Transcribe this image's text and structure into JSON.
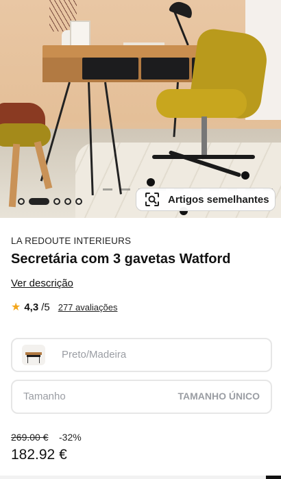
{
  "hero": {
    "image_description_icon": "product-photo",
    "carousel": {
      "count": 5,
      "active_index": 1
    },
    "similar_button": {
      "label": "Artigos semelhantes",
      "icon": "image-search-icon"
    }
  },
  "product": {
    "brand": "LA REDOUTE INTERIEURS",
    "title": "Secretária com 3 gavetas Watford",
    "description_link": "Ver descrição",
    "rating": {
      "score": "4,3",
      "out_of": "/5",
      "reviews": "277 avaliações",
      "star_color": "#f3a61b"
    }
  },
  "selectors": {
    "color": {
      "value": "Preto/Madeira"
    },
    "size": {
      "label": "Tamanho",
      "value": "TAMANHO ÚNICO"
    }
  },
  "price": {
    "original": "269.00 €",
    "discount": "-32%",
    "current": "182.92 €"
  }
}
